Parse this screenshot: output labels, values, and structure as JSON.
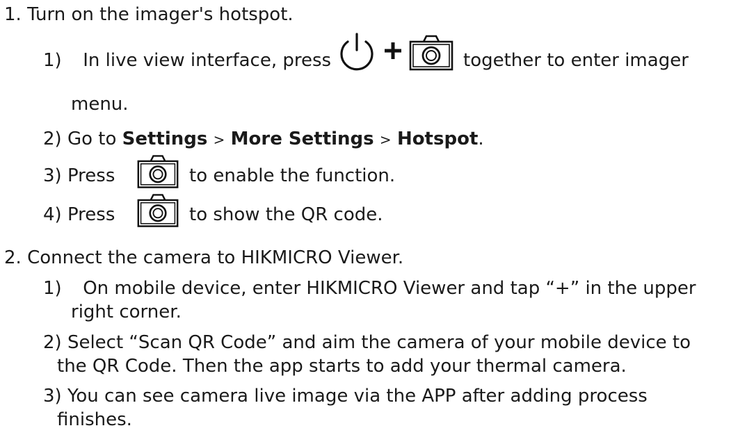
{
  "step1": {
    "number": "1.",
    "title": "Turn on the imager's hotspot.",
    "sub1": {
      "number": "1)",
      "text_before": "In live view interface, press",
      "plus": "+",
      "text_after": "together to enter imager",
      "text_cont": "menu.",
      "icons": [
        "power-icon",
        "camera-icon"
      ]
    },
    "sub2": {
      "number": "2)",
      "text_before": "Go to",
      "item1": "Settings",
      "sep1": ">",
      "item2": "More Settings",
      "sep2": ">",
      "item3": "Hotspot",
      "end": "."
    },
    "sub3": {
      "number": "3)",
      "text_before": "Press",
      "text_after": "to enable the function.",
      "icon": "camera-icon"
    },
    "sub4": {
      "number": "4)",
      "text_before": "Press",
      "text_after": "to show the QR code.",
      "icon": "camera-icon"
    }
  },
  "step2": {
    "number": "2.",
    "title": "Connect the camera to HIKMICRO Viewer.",
    "sub1": {
      "number": "1)",
      "line1": "On mobile device, enter HIKMICRO Viewer and tap “+” in the upper",
      "line2": "right corner."
    },
    "sub2": {
      "number": "2)",
      "line1": "Select “Scan QR Code” and aim the camera of your mobile device to",
      "line2": "the QR Code. Then the app starts to add your thermal camera."
    },
    "sub3": {
      "number": "3)",
      "line1": "You can see camera live image via the APP after adding process",
      "line2": "finishes."
    }
  }
}
